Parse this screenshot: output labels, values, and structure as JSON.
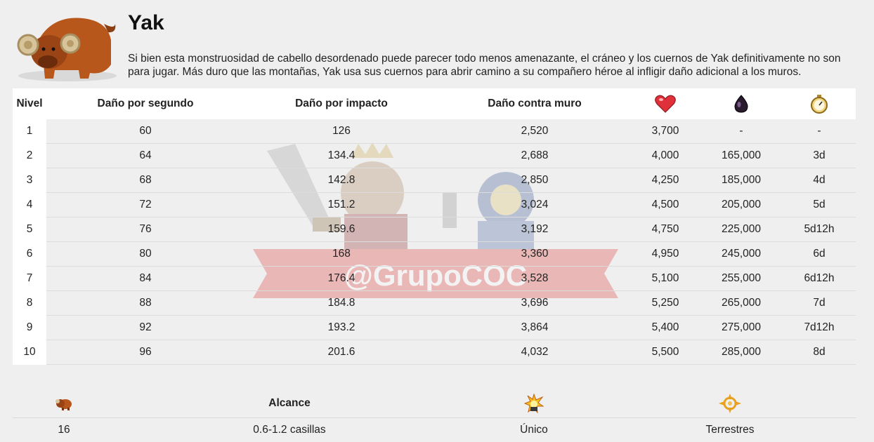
{
  "pet": {
    "name": "Yak",
    "description": "Si bien esta monstruosidad de cabello desordenado puede parecer todo menos amenazante, el cráneo y los cuernos de Yak definitivamente no son para jugar. Más duro que las montañas, Yak usa sus cuernos para abrir camino a su compañero héroe al infligir daño adicional a los muros."
  },
  "watermark_text": "@GrupoCOC",
  "table": {
    "headers": {
      "level": "Nivel",
      "dps": "Daño por segundo",
      "dph": "Daño por impacto",
      "wall": "Daño contra muro",
      "hp_icon": "heart-icon",
      "cost_icon": "dark-elixir-icon",
      "time_icon": "stopwatch-icon"
    },
    "rows": [
      {
        "level": "1",
        "dps": "60",
        "dph": "126",
        "wall": "2,520",
        "hp": "3,700",
        "cost": "-",
        "time": "-"
      },
      {
        "level": "2",
        "dps": "64",
        "dph": "134.4",
        "wall": "2,688",
        "hp": "4,000",
        "cost": "165,000",
        "time": "3d"
      },
      {
        "level": "3",
        "dps": "68",
        "dph": "142.8",
        "wall": "2,850",
        "hp": "4,250",
        "cost": "185,000",
        "time": "4d"
      },
      {
        "level": "4",
        "dps": "72",
        "dph": "151.2",
        "wall": "3,024",
        "hp": "4,500",
        "cost": "205,000",
        "time": "5d"
      },
      {
        "level": "5",
        "dps": "76",
        "dph": "159.6",
        "wall": "3,192",
        "hp": "4,750",
        "cost": "225,000",
        "time": "5d12h"
      },
      {
        "level": "6",
        "dps": "80",
        "dph": "168",
        "wall": "3,360",
        "hp": "4,950",
        "cost": "245,000",
        "time": "6d"
      },
      {
        "level": "7",
        "dps": "84",
        "dph": "176.4",
        "wall": "3,528",
        "hp": "5,100",
        "cost": "255,000",
        "time": "6d12h"
      },
      {
        "level": "8",
        "dps": "88",
        "dph": "184.8",
        "wall": "3,696",
        "hp": "5,250",
        "cost": "265,000",
        "time": "7d"
      },
      {
        "level": "9",
        "dps": "92",
        "dph": "193.2",
        "wall": "3,864",
        "hp": "5,400",
        "cost": "275,000",
        "time": "7d12h"
      },
      {
        "level": "10",
        "dps": "96",
        "dph": "201.6",
        "wall": "4,032",
        "hp": "5,500",
        "cost": "285,000",
        "time": "8d"
      }
    ]
  },
  "footer": {
    "headers": {
      "speed_icon": "yak-speed-icon",
      "range_label": "Alcance",
      "target_icon": "explosion-icon",
      "type_icon": "crosshair-icon"
    },
    "values": {
      "speed": "16",
      "range": "0.6-1.2 casillas",
      "target": "Único",
      "type": "Terrestres"
    }
  }
}
